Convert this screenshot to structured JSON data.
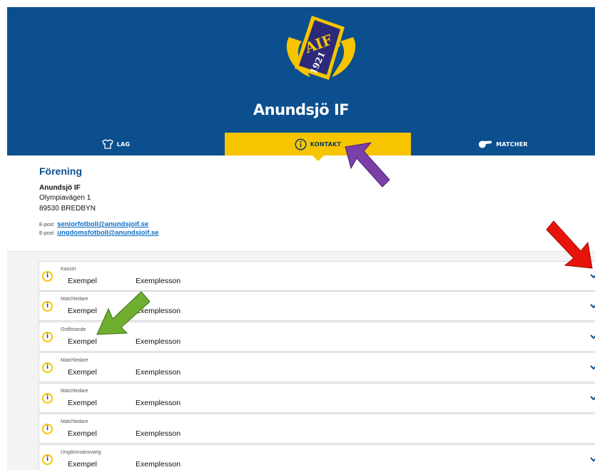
{
  "club": {
    "name": "Anundsjö IF",
    "logo_text": "AIF",
    "logo_year": "1921"
  },
  "nav": [
    {
      "label": "LAG",
      "icon": "shirt-icon"
    },
    {
      "label": "KONTAKT",
      "icon": "info-icon",
      "active": true
    },
    {
      "label": "MATCHER",
      "icon": "whistle-icon"
    }
  ],
  "association": {
    "heading": "Förening",
    "name": "Anundsjö IF",
    "street": "Olympiavägen 1",
    "postal": "89530 BREDBYN",
    "emails": [
      {
        "label": "E-post",
        "address": "seniorfotboll@anundsjoif.se"
      },
      {
        "label": "E-post",
        "address": "ungdomsfotboll@anundsjoif.se"
      }
    ]
  },
  "contacts": [
    {
      "role": "Kassör",
      "first": "Exempel",
      "last": "Exemplesson",
      "expandable": true
    },
    {
      "role": "Matchledare",
      "first": "Exempel",
      "last": "Exemplesson",
      "expandable": true
    },
    {
      "role": "Ordförande",
      "first": "Exempel",
      "last": "Exemplesson",
      "expandable": true
    },
    {
      "role": "Matchledare",
      "first": "Exempel",
      "last": "Exemplesson",
      "expandable": true
    },
    {
      "role": "Matchledare",
      "first": "Exempel",
      "last": "Exemplesson",
      "expandable": true
    },
    {
      "role": "Matchledare",
      "first": "Exempel",
      "last": "Exemplesson",
      "expandable": false
    },
    {
      "role": "Ungdomsansvarig",
      "first": "Exempel",
      "last": "Exemplesson",
      "expandable": true
    }
  ],
  "colors": {
    "brand_blue": "#0b4f8e",
    "brand_yellow": "#f6c500",
    "link_blue": "#0c6fc4",
    "annotation_purple": "#7b3fa8",
    "annotation_red": "#e8140c",
    "annotation_green": "#6fae2f"
  }
}
